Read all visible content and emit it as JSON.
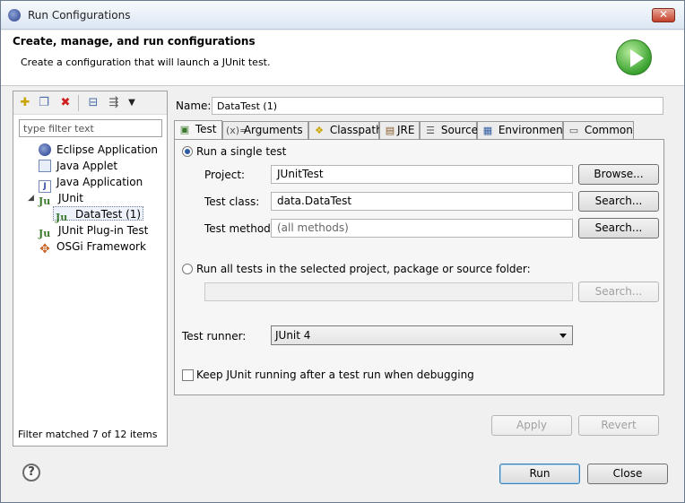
{
  "window": {
    "title": "Run Configurations",
    "close_label": "✕"
  },
  "header": {
    "title": "Create, manage, and run configurations",
    "description": "Create a configuration that will launch a JUnit test."
  },
  "left_pane": {
    "filter_placeholder": "type filter text",
    "toolbar_icons": [
      "new-config-icon",
      "duplicate-icon",
      "delete-icon",
      "collapse-all-icon",
      "filter-icon",
      "view-menu-icon"
    ],
    "tree": [
      {
        "label": "Eclipse Application",
        "icon": "eclipse-app-icon"
      },
      {
        "label": "Java Applet",
        "icon": "java-applet-icon"
      },
      {
        "label": "Java Application",
        "icon": "java-app-icon"
      },
      {
        "label": "JUnit",
        "icon": "junit-icon",
        "expanded": true
      },
      {
        "label": "DataTest (1)",
        "icon": "junit-icon",
        "selected": true
      },
      {
        "label": "JUnit Plug-in Test",
        "icon": "junit-plugin-icon"
      },
      {
        "label": "OSGi Framework",
        "icon": "osgi-icon"
      }
    ],
    "status": "Filter matched 7 of 12 items"
  },
  "editor": {
    "name_label": "Name:",
    "name_value": "DataTest (1)",
    "tabs": [
      {
        "label": "Test",
        "active": true
      },
      {
        "label": "Arguments"
      },
      {
        "label": "Classpath"
      },
      {
        "label": "JRE"
      },
      {
        "label": "Source"
      },
      {
        "label": "Environment"
      },
      {
        "label": "Common"
      }
    ],
    "single_test_label": "Run a single test",
    "project_label": "Project:",
    "project_value": "JUnitTest",
    "browse_label": "Browse...",
    "test_class_label": "Test class:",
    "test_class_value": "data.DataTest",
    "search_label": "Search...",
    "test_method_label": "Test method:",
    "test_method_placeholder": "(all methods)",
    "all_tests_label": "Run all tests in the selected project, package or source folder:",
    "test_runner_label": "Test runner:",
    "test_runner_value": "JUnit 4",
    "keep_running_label": "Keep JUnit running after a test run when debugging",
    "apply_label": "Apply",
    "revert_label": "Revert"
  },
  "footer": {
    "help_label": "?",
    "run_label": "Run",
    "close_label": "Close"
  }
}
